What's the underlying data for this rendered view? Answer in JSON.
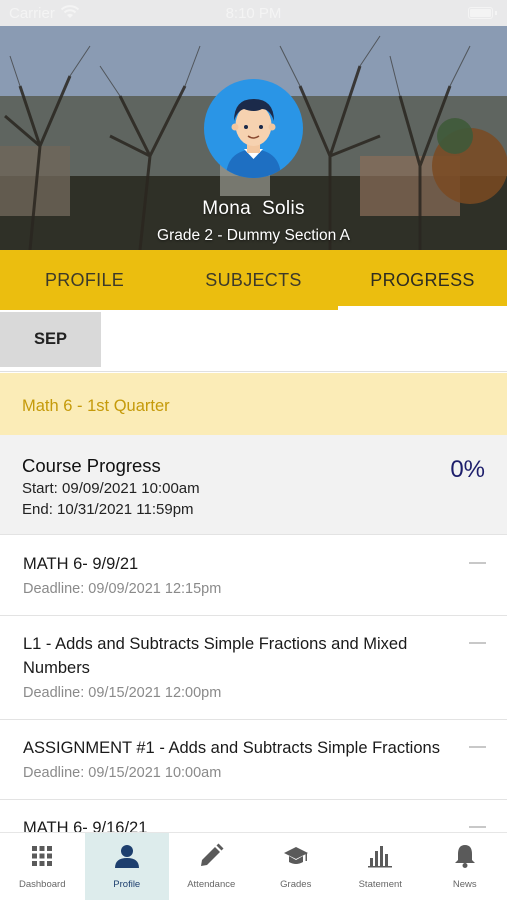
{
  "status_bar": {
    "carrier": "Carrier",
    "time": "8:10 PM"
  },
  "profile": {
    "name": "Mona  Solis",
    "section": "Grade 2 - Dummy Section A",
    "avatar_color": "#2a95e6"
  },
  "tabs": [
    {
      "label": "PROFILE",
      "active": false
    },
    {
      "label": "SUBJECTS",
      "active": false
    },
    {
      "label": "PROGRESS",
      "active": true
    }
  ],
  "month_filter": {
    "selected": "SEP"
  },
  "subject": {
    "title": "Math 6 - 1st Quarter"
  },
  "course_progress": {
    "title": "Course Progress",
    "start": "Start: 09/09/2021 10:00am",
    "end": "End: 10/31/2021 11:59pm",
    "percent": "0%"
  },
  "activities": [
    {
      "title": "MATH 6- 9/9/21",
      "deadline": "Deadline: 09/09/2021 12:15pm"
    },
    {
      "title": "L1 - Adds and Subtracts Simple Fractions and Mixed Numbers",
      "deadline": "Deadline: 09/15/2021 12:00pm"
    },
    {
      "title": "ASSIGNMENT #1 - Adds and Subtracts Simple Fractions",
      "deadline": "Deadline: 09/15/2021 10:00am"
    },
    {
      "title": "MATH 6- 9/16/21",
      "deadline": ""
    }
  ],
  "bottom_nav": [
    {
      "label": "Dashboard",
      "icon": "grid-icon",
      "active": false
    },
    {
      "label": "Profile",
      "icon": "person-icon",
      "active": true
    },
    {
      "label": "Attendance",
      "icon": "pencil-icon",
      "active": false
    },
    {
      "label": "Grades",
      "icon": "graduation-cap-icon",
      "active": false
    },
    {
      "label": "Statement",
      "icon": "bar-chart-icon",
      "active": false
    },
    {
      "label": "News",
      "icon": "bell-icon",
      "active": false
    }
  ],
  "colors": {
    "tab_bar": "#ebbe0f",
    "subject_header_bg": "#fbecb7",
    "subject_header_text": "#c59a0a",
    "percent_text": "#1d1e6b",
    "active_nav_bg": "#ddecec",
    "active_nav_icon": "#1d3f6e"
  }
}
